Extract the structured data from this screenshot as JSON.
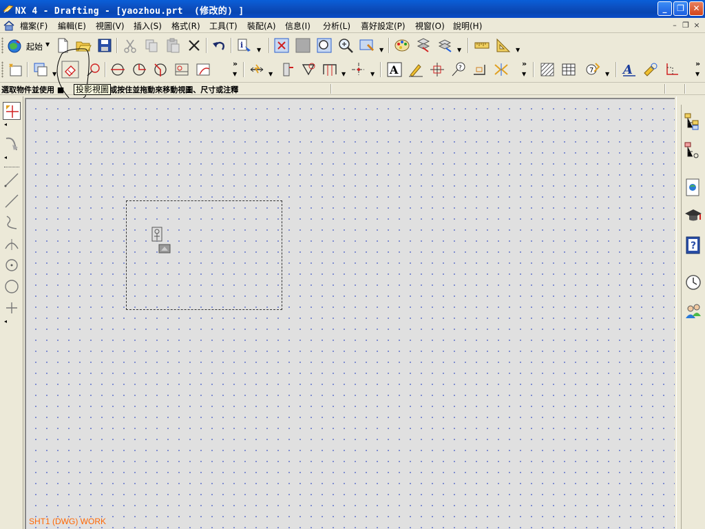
{
  "window": {
    "title": "NX 4 - Drafting - [yaozhou.prt  (修改的) ]",
    "minimize": "_",
    "restore": "❐",
    "close": "✕"
  },
  "menubar": {
    "items": [
      "檔案(F)",
      "編輯(E)",
      "視圖(V)",
      "插入(S)",
      "格式(R)",
      "工具(T)",
      "裝配(A)",
      "信息(I)",
      "分析(L)",
      "喜好設定(P)",
      "視窗(O)",
      "說明(H)"
    ],
    "mdi_minimize": "–",
    "mdi_restore": "❐",
    "mdi_close": "×"
  },
  "toolbar": {
    "start_label": "起始",
    "more": "»"
  },
  "cue": {
    "text": "選取物件並使用 ■",
    "text_rest": "擎，或按住並拖動來移動視圖、尺寸或注釋",
    "tooltip": "投影視圖"
  },
  "canvas": {
    "sheet_label": "SHT1 (DWG) WORK"
  },
  "icons": {
    "app": "nx-logo-icon",
    "start": "globe-start-icon",
    "new": "new-file-icon",
    "open": "open-folder-icon",
    "save": "save-disk-icon",
    "cut": "scissors-icon",
    "copy": "copy-icon",
    "paste": "paste-icon",
    "delete": "delete-x-icon",
    "undo": "undo-arrow-icon",
    "info": "info-icon",
    "fit": "fit-view-icon",
    "zoom": "zoom-icon",
    "palette": "palette-icon",
    "ruler": "ruler-icon",
    "clock": "clock-icon",
    "help": "help-book-icon",
    "users": "users-icon"
  },
  "colors": {
    "titlebar": "#0a4cc8",
    "canvas": "#e0e0e0",
    "grid_dot": "#6677cc",
    "sheet_label": "#ff6600",
    "tooltip_bg": "#ffffe1"
  }
}
